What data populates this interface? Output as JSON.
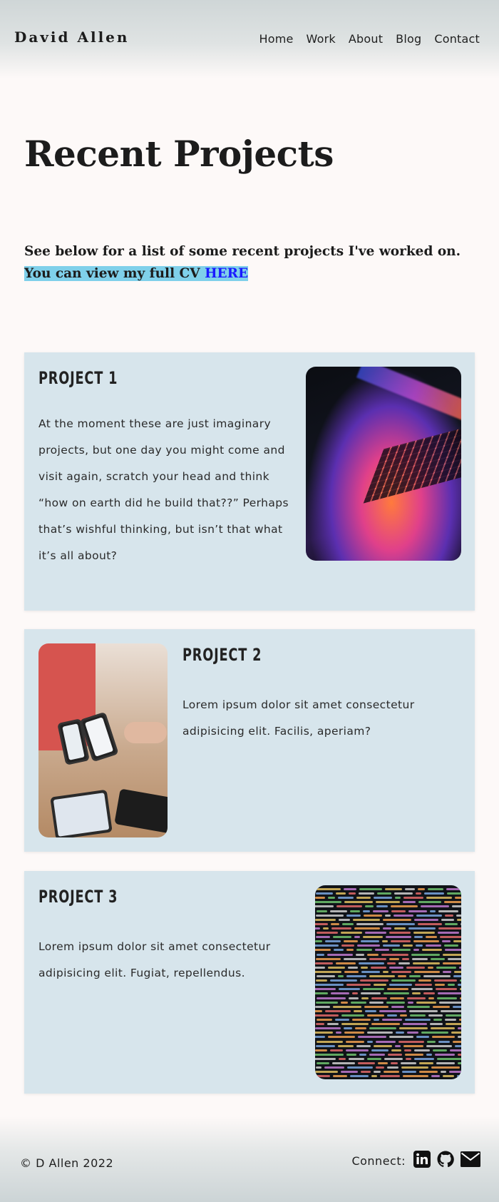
{
  "header": {
    "brand": "David Allen",
    "nav": [
      "Home",
      "Work",
      "About",
      "Blog",
      "Contact"
    ]
  },
  "main": {
    "title": "Recent Projects",
    "intro_text": "See below for a list of some recent projects I've worked on. ",
    "intro_highlight": "You can view my full CV ",
    "cv_link": "HERE",
    "projects": [
      {
        "title": "PROJECT 1",
        "body": "At the moment these are just imaginary projects, but one day you might come and visit again, scratch your head and think “how on earth did he build that??” Perhaps that’s wishful thinking, but isn’t that what it’s all about?",
        "image": "laptop-photo"
      },
      {
        "title": "PROJECT 2",
        "body": "Lorem ipsum dolor sit amet consectetur adipisicing elit. Facilis, aperiam?",
        "image": "phones-photo"
      },
      {
        "title": "PROJECT 3",
        "body": "Lorem ipsum dolor sit amet consectetur adipisicing elit. Fugiat, repellendus.",
        "image": "code-photo"
      }
    ]
  },
  "footer": {
    "copyright": "© D Allen 2022",
    "connect_label": "Connect:",
    "icons": [
      "linkedin-icon",
      "github-icon",
      "email-icon"
    ]
  },
  "colors": {
    "background": "#fdf9f8",
    "card": "#d7e5ec",
    "highlight": "#7fd0ea",
    "link": "#1a1aff"
  }
}
